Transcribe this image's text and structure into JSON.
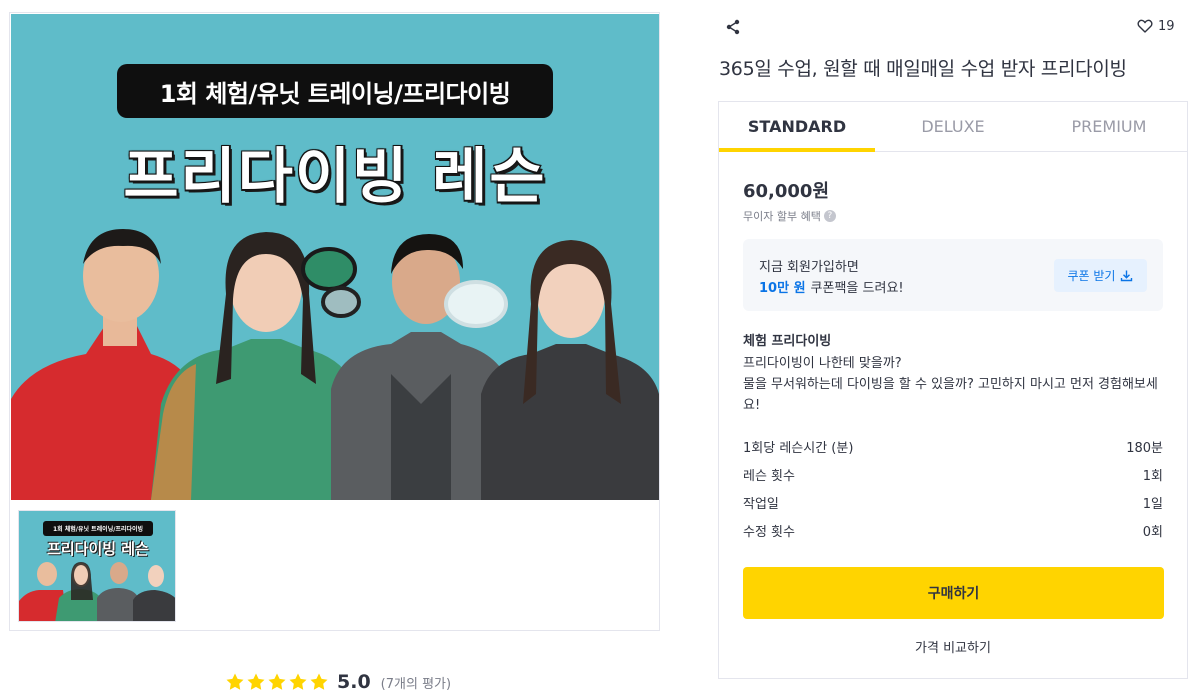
{
  "hero": {
    "badge": "1회 체험/유닛 트레이닝/프리다이빙",
    "title": "프리다이빙 레슨"
  },
  "thumbnail": {
    "badge": "1회 체험/유닛 트레이닝/프리다이빙",
    "title": "프리다이빙 레슨"
  },
  "rating": {
    "stars": 5,
    "score": "5.0",
    "count": "(7개의 평가)"
  },
  "header": {
    "like_count": "19",
    "title": "365일 수업, 원할 때 매일매일 수업 받자 프리다이빙"
  },
  "tabs": [
    {
      "label": "STANDARD",
      "active": true
    },
    {
      "label": "DELUXE",
      "active": false
    },
    {
      "label": "PREMIUM",
      "active": false
    }
  ],
  "package": {
    "price": "60,000원",
    "installment": "무이자 할부 혜택",
    "coupon": {
      "line1": "지금 회원가입하면",
      "amount": "10만 원",
      "line2_rest": "쿠폰팩을 드려요!",
      "button": "쿠폰 받기"
    },
    "name": "체험 프리다이빙",
    "description_line1": "프리다이빙이 나한테 맞을까?",
    "description_line2": "물을 무서워하는데 다이빙을 할 수 있을까? 고민하지 마시고 먼저 경험해보세요!",
    "specs": [
      {
        "label": "1회당 레슨시간 (분)",
        "value": "180분"
      },
      {
        "label": "레슨 횟수",
        "value": "1회"
      },
      {
        "label": "작업일",
        "value": "1일"
      },
      {
        "label": "수정 횟수",
        "value": "0회"
      }
    ],
    "buy_button": "구매하기",
    "compare_link": "가격 비교하기"
  },
  "colors": {
    "accent_yellow": "#ffd400",
    "link_blue": "#0a74e6",
    "hero_teal": "#5fbcc9"
  }
}
